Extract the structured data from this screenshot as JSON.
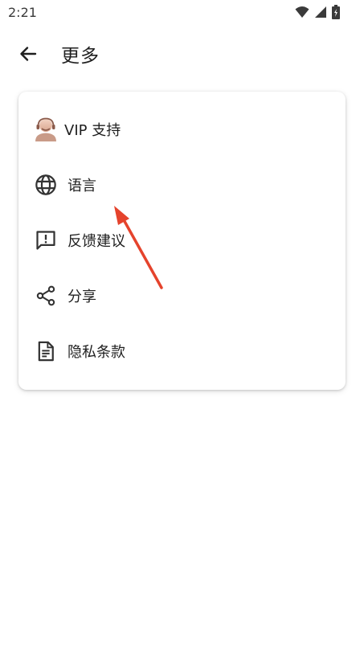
{
  "status_bar": {
    "time": "2:21",
    "icons": [
      "wifi-icon",
      "signal-icon",
      "battery-icon"
    ]
  },
  "app_bar": {
    "back_icon": "arrow-left-icon",
    "title": "更多"
  },
  "menu": {
    "items": [
      {
        "label": "VIP 支持",
        "icon": "support-agent-icon"
      },
      {
        "label": "语言",
        "icon": "globe-icon"
      },
      {
        "label": "反馈建议",
        "icon": "feedback-icon"
      },
      {
        "label": "分享",
        "icon": "share-icon"
      },
      {
        "label": "隐私条款",
        "icon": "document-icon"
      }
    ]
  },
  "colors": {
    "annotation_arrow": "#e5432c",
    "icon": "#333333",
    "text": "#1f1f1f"
  }
}
